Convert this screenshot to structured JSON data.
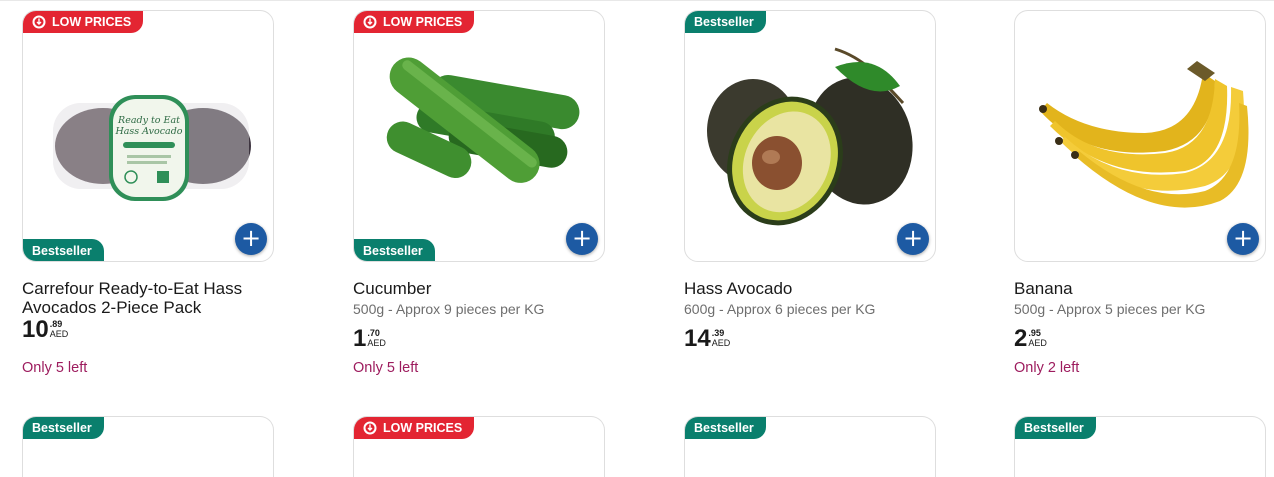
{
  "products": [
    {
      "badge_top": "LOW PRICES",
      "badge_bottom": "Bestseller",
      "title": "Carrefour Ready-to-Eat Hass Avocados 2-Piece Pack",
      "subtitle": "",
      "price_int": "10",
      "price_cents": ".89",
      "currency": "AED",
      "stock": "Only 5 left",
      "package_text_1": "Ready to Eat",
      "package_text_2": "Hass Avocado",
      "image": "avocado-pack"
    },
    {
      "badge_top": "LOW PRICES",
      "badge_bottom": "Bestseller",
      "title": "Cucumber",
      "subtitle": "500g - Approx 9 pieces per KG",
      "price_int": "1",
      "price_cents": ".70",
      "currency": "AED",
      "stock": "Only 5 left",
      "image": "cucumber"
    },
    {
      "badge_top": "Bestseller",
      "badge_bottom": "",
      "title": "Hass Avocado",
      "subtitle": "600g - Approx 6 pieces per KG",
      "price_int": "14",
      "price_cents": ".39",
      "currency": "AED",
      "stock": "",
      "image": "avocado"
    },
    {
      "badge_top": "",
      "badge_bottom": "",
      "title": "Banana",
      "subtitle": "500g - Approx 5 pieces per KG",
      "price_int": "2",
      "price_cents": ".95",
      "currency": "AED",
      "stock": "Only 2 left",
      "image": "banana"
    }
  ],
  "row2": [
    {
      "badge": "Bestseller"
    },
    {
      "badge": "LOW PRICES"
    },
    {
      "badge": "Bestseller"
    },
    {
      "badge": "Bestseller"
    }
  ],
  "add_label": "+",
  "colors": {
    "low_prices": "#e32532",
    "bestseller": "#0a7f6d",
    "add_button": "#1d5aa3",
    "stock": "#9d1c5e"
  }
}
